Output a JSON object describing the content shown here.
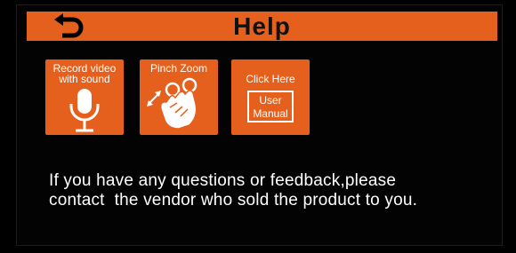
{
  "header": {
    "title": "Help",
    "back_icon": "back-arrow-icon"
  },
  "tiles": [
    {
      "label_line1": "Record video",
      "label_line2": "with sound",
      "icon": "microphone-icon"
    },
    {
      "label": "Pinch Zoom",
      "icon": "pinch-zoom-hand-icon"
    },
    {
      "label": "Click Here",
      "box_line1": "User",
      "box_line2": "Manual"
    }
  ],
  "message": {
    "line1": "If you have any questions or feedback,please",
    "line2": "contact  the vendor who sold the product to you."
  },
  "colors": {
    "accent": "#e5601d",
    "background": "#000000",
    "title_text": "#111111",
    "text": "#ffffff"
  }
}
